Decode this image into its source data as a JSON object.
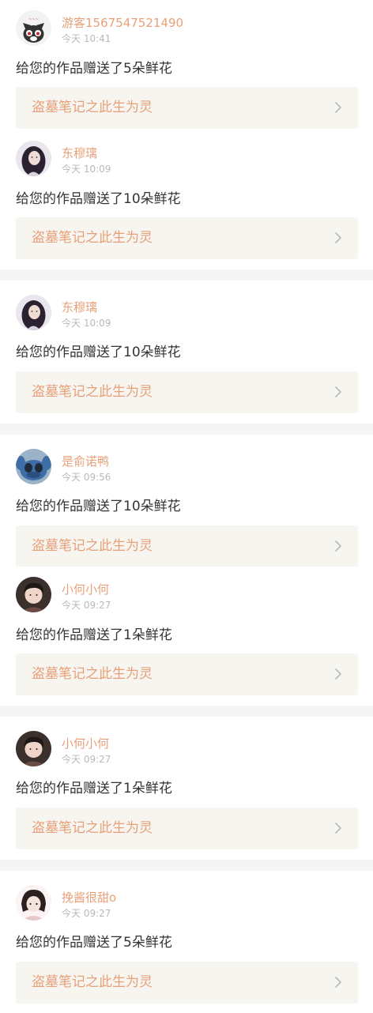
{
  "gift_messages": [
    {
      "user": "游客1567547521490",
      "time": "今天 10:41",
      "message": "给您的作品赠送了5朵鲜花",
      "work_title": "盗墓笔记之此生为灵",
      "avatar": "cat-avatar"
    },
    {
      "user": "东穆璃",
      "time": "今天 10:09",
      "message": "给您的作品赠送了10朵鲜花",
      "work_title": "盗墓笔记之此生为灵",
      "avatar": "girl-avatar"
    },
    {
      "user": "东穆璃",
      "time": "今天 10:09",
      "message": "给您的作品赠送了10朵鲜花",
      "work_title": "盗墓笔记之此生为灵",
      "avatar": "girl-avatar"
    },
    {
      "user": "是俞诺鸭",
      "time": "今天 09:56",
      "message": "给您的作品赠送了10朵鲜花",
      "work_title": "盗墓笔记之此生为灵",
      "avatar": "blue-creature-avatar"
    },
    {
      "user": "小何小何",
      "time": "今天 09:27",
      "message": "给您的作品赠送了1朵鲜花",
      "work_title": "盗墓笔记之此生为灵",
      "avatar": "boy-avatar"
    },
    {
      "user": "小何小何",
      "time": "今天 09:27",
      "message": "给您的作品赠送了1朵鲜花",
      "work_title": "盗墓笔记之此生为灵",
      "avatar": "boy-avatar"
    },
    {
      "user": "挽酱很甜o",
      "time": "今天 09:27",
      "message": "给您的作品赠送了5朵鲜花",
      "work_title": "盗墓笔记之此生为灵",
      "avatar": "anime-girl-avatar"
    }
  ],
  "colors": {
    "accent": "#e8a07a",
    "timestamp": "#b9b9b9",
    "text": "#333333",
    "work_bg": "#f6f5ef",
    "chevron": "#b8b8b8",
    "divider": "#f5f5f5"
  }
}
